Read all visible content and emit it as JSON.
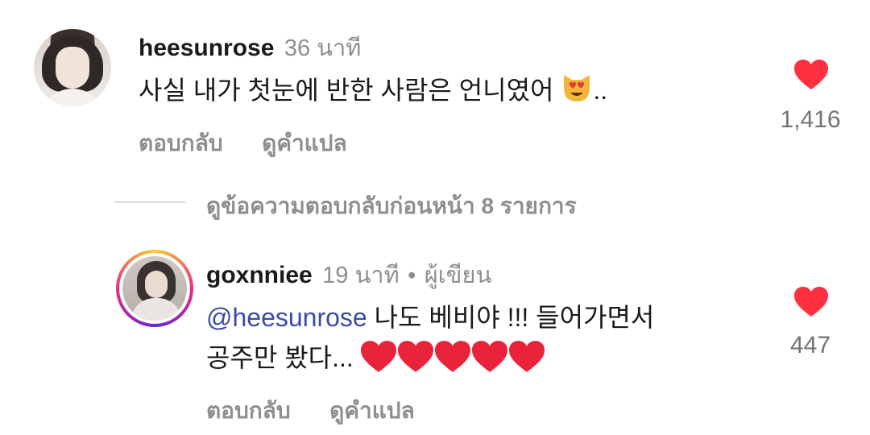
{
  "comments": [
    {
      "username": "heesunrose",
      "time": "36 นาที",
      "text": "사실 내가 첫눈에 반한 사람은 언니였어",
      "text_suffix": "..",
      "likes": "1,416",
      "reply_label": "ตอบกลับ",
      "translate_label": "ดูคำแปล",
      "emoji": "heart-eyes-cat"
    },
    {
      "username": "goxnniee",
      "time": "19 นาที",
      "separator": "•",
      "role": "ผู้เขียน",
      "mention": "@heesunrose",
      "text_line1": "나도 베비야 !!! 들어가면서",
      "text_line2": "공주만 봤다...",
      "likes": "447",
      "reply_label": "ตอบกลับ",
      "translate_label": "ดูคำแปล",
      "emoji": "red-hearts-x5"
    }
  ],
  "view_replies": "ดูข้อความตอบกลับก่อนหน้า 8 รายการ",
  "colors": {
    "like_red": "#ff3040",
    "secondary_text": "#8e8e8e",
    "mention_blue": "#3a4ba8"
  }
}
